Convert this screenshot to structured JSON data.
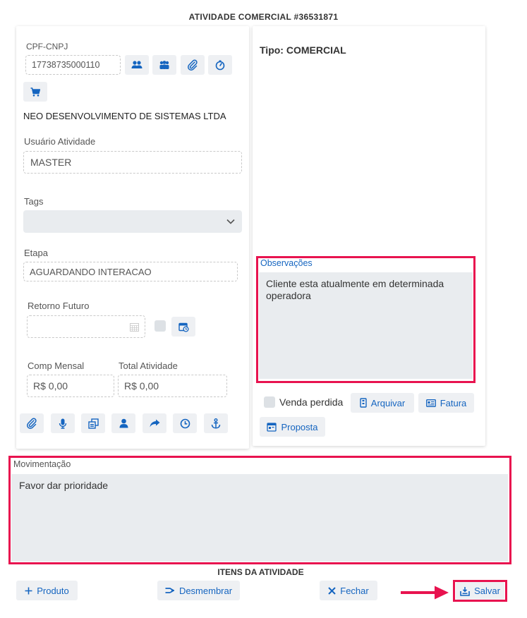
{
  "header": {
    "title": "ATIVIDADE COMERCIAL #36531871"
  },
  "left": {
    "cpf_label": "CPF-CNPJ",
    "cpf_value": "17738735000110",
    "company": "NEO DESENVOLVIMENTO DE SISTEMAS LTDA",
    "usuario_label": "Usuário Atividade",
    "usuario_value": "MASTER",
    "tags_label": "Tags",
    "etapa_label": "Etapa",
    "etapa_value": "AGUARDANDO INTERACAO",
    "retorno_label": "Retorno Futuro",
    "comp_label": "Comp Mensal",
    "comp_value": "R$ 0,00",
    "total_label": "Total Atividade",
    "total_value": "R$ 0,00"
  },
  "right": {
    "tipo": "Tipo: COMERCIAL",
    "obs_label": "Observações",
    "obs_value": "Cliente esta atualmente em determinada operadora",
    "venda_perdida": "Venda perdida",
    "arquivar": "Arquivar",
    "fatura": "Fatura",
    "proposta": "Proposta"
  },
  "movimentacao": {
    "label": "Movimentação",
    "value": "Favor dar prioridade"
  },
  "itens": {
    "title": "ITENS DA ATIVIDADE",
    "produto": "Produto",
    "desmembrar": "Desmembrar",
    "fechar": "Fechar",
    "salvar": "Salvar"
  },
  "colors": {
    "accent": "#1565c0",
    "highlight": "#e8134f",
    "field_bg": "#e9ecef"
  }
}
